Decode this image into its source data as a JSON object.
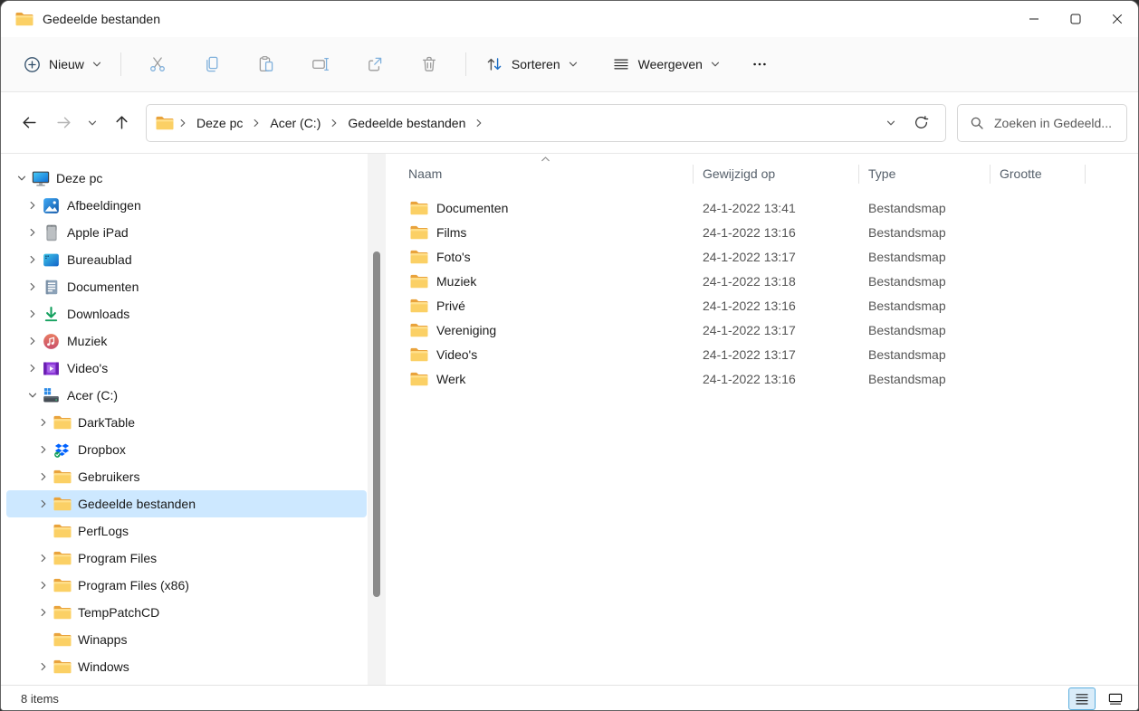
{
  "window": {
    "title": "Gedeelde bestanden",
    "controls": [
      {
        "id": "minimize"
      },
      {
        "id": "maximize"
      },
      {
        "id": "close"
      }
    ]
  },
  "toolbar": {
    "new_label": "Nieuw",
    "actions": [
      {
        "id": "cut"
      },
      {
        "id": "copy"
      },
      {
        "id": "paste"
      },
      {
        "id": "rename"
      },
      {
        "id": "share"
      },
      {
        "id": "delete"
      }
    ],
    "sort_label": "Sorteren",
    "view_label": "Weergeven",
    "more_label": "more-options"
  },
  "addressbar": {
    "breadcrumbs": [
      "Deze pc",
      "Acer (C:)",
      "Gedeelde bestanden"
    ],
    "search_placeholder": "Zoeken in Gedeeld..."
  },
  "sidebar": {
    "items": [
      {
        "label": "Deze pc",
        "depth": 0,
        "chevron": "expanded",
        "icon": "monitor-icon",
        "selected": false
      },
      {
        "label": "Afbeeldingen",
        "depth": 1,
        "chevron": "collapsed",
        "icon": "pictures-icon",
        "selected": false
      },
      {
        "label": "Apple iPad",
        "depth": 1,
        "chevron": "collapsed",
        "icon": "tablet-icon",
        "selected": false
      },
      {
        "label": "Bureaublad",
        "depth": 1,
        "chevron": "collapsed",
        "icon": "desktop-icon",
        "selected": false
      },
      {
        "label": "Documenten",
        "depth": 1,
        "chevron": "collapsed",
        "icon": "documents-icon",
        "selected": false
      },
      {
        "label": "Downloads",
        "depth": 1,
        "chevron": "collapsed",
        "icon": "downloads-icon",
        "selected": false
      },
      {
        "label": "Muziek",
        "depth": 1,
        "chevron": "collapsed",
        "icon": "music-icon",
        "selected": false
      },
      {
        "label": "Video's",
        "depth": 1,
        "chevron": "collapsed",
        "icon": "videos-icon",
        "selected": false
      },
      {
        "label": "Acer (C:)",
        "depth": 1,
        "chevron": "expanded",
        "icon": "drive-icon",
        "selected": false
      },
      {
        "label": "DarkTable",
        "depth": 2,
        "chevron": "collapsed",
        "icon": "folder-icon",
        "selected": false
      },
      {
        "label": "Dropbox",
        "depth": 2,
        "chevron": "collapsed",
        "icon": "dropbox-icon",
        "selected": false
      },
      {
        "label": "Gebruikers",
        "depth": 2,
        "chevron": "collapsed",
        "icon": "folder-icon",
        "selected": false
      },
      {
        "label": "Gedeelde bestanden",
        "depth": 2,
        "chevron": "collapsed",
        "icon": "folder-icon",
        "selected": true
      },
      {
        "label": "PerfLogs",
        "depth": 2,
        "chevron": "none",
        "icon": "folder-icon",
        "selected": false
      },
      {
        "label": "Program Files",
        "depth": 2,
        "chevron": "collapsed",
        "icon": "folder-icon",
        "selected": false
      },
      {
        "label": "Program Files (x86)",
        "depth": 2,
        "chevron": "collapsed",
        "icon": "folder-icon",
        "selected": false
      },
      {
        "label": "TempPatchCD",
        "depth": 2,
        "chevron": "collapsed",
        "icon": "folder-icon",
        "selected": false
      },
      {
        "label": "Winapps",
        "depth": 2,
        "chevron": "none",
        "icon": "folder-icon",
        "selected": false
      },
      {
        "label": "Windows",
        "depth": 2,
        "chevron": "collapsed",
        "icon": "folder-icon",
        "selected": false
      }
    ]
  },
  "main": {
    "columns": [
      "Naam",
      "Gewijzigd op",
      "Type",
      "Grootte"
    ],
    "sort_column": "Naam",
    "sort_direction": "ascending",
    "rows": [
      {
        "name": "Documenten",
        "modified": "24-1-2022 13:41",
        "type": "Bestandsmap",
        "size": ""
      },
      {
        "name": "Films",
        "modified": "24-1-2022 13:16",
        "type": "Bestandsmap",
        "size": ""
      },
      {
        "name": "Foto's",
        "modified": "24-1-2022 13:17",
        "type": "Bestandsmap",
        "size": ""
      },
      {
        "name": "Muziek",
        "modified": "24-1-2022 13:18",
        "type": "Bestandsmap",
        "size": ""
      },
      {
        "name": "Privé",
        "modified": "24-1-2022 13:16",
        "type": "Bestandsmap",
        "size": ""
      },
      {
        "name": "Vereniging",
        "modified": "24-1-2022 13:17",
        "type": "Bestandsmap",
        "size": ""
      },
      {
        "name": "Video's",
        "modified": "24-1-2022 13:17",
        "type": "Bestandsmap",
        "size": ""
      },
      {
        "name": "Werk",
        "modified": "24-1-2022 13:16",
        "type": "Bestandsmap",
        "size": ""
      }
    ]
  },
  "statusbar": {
    "items_count": "8 items"
  },
  "colors": {
    "selection": "#cde8ff",
    "accent_blue": "#1c6dc4",
    "folder_yellow": "#fad064"
  }
}
